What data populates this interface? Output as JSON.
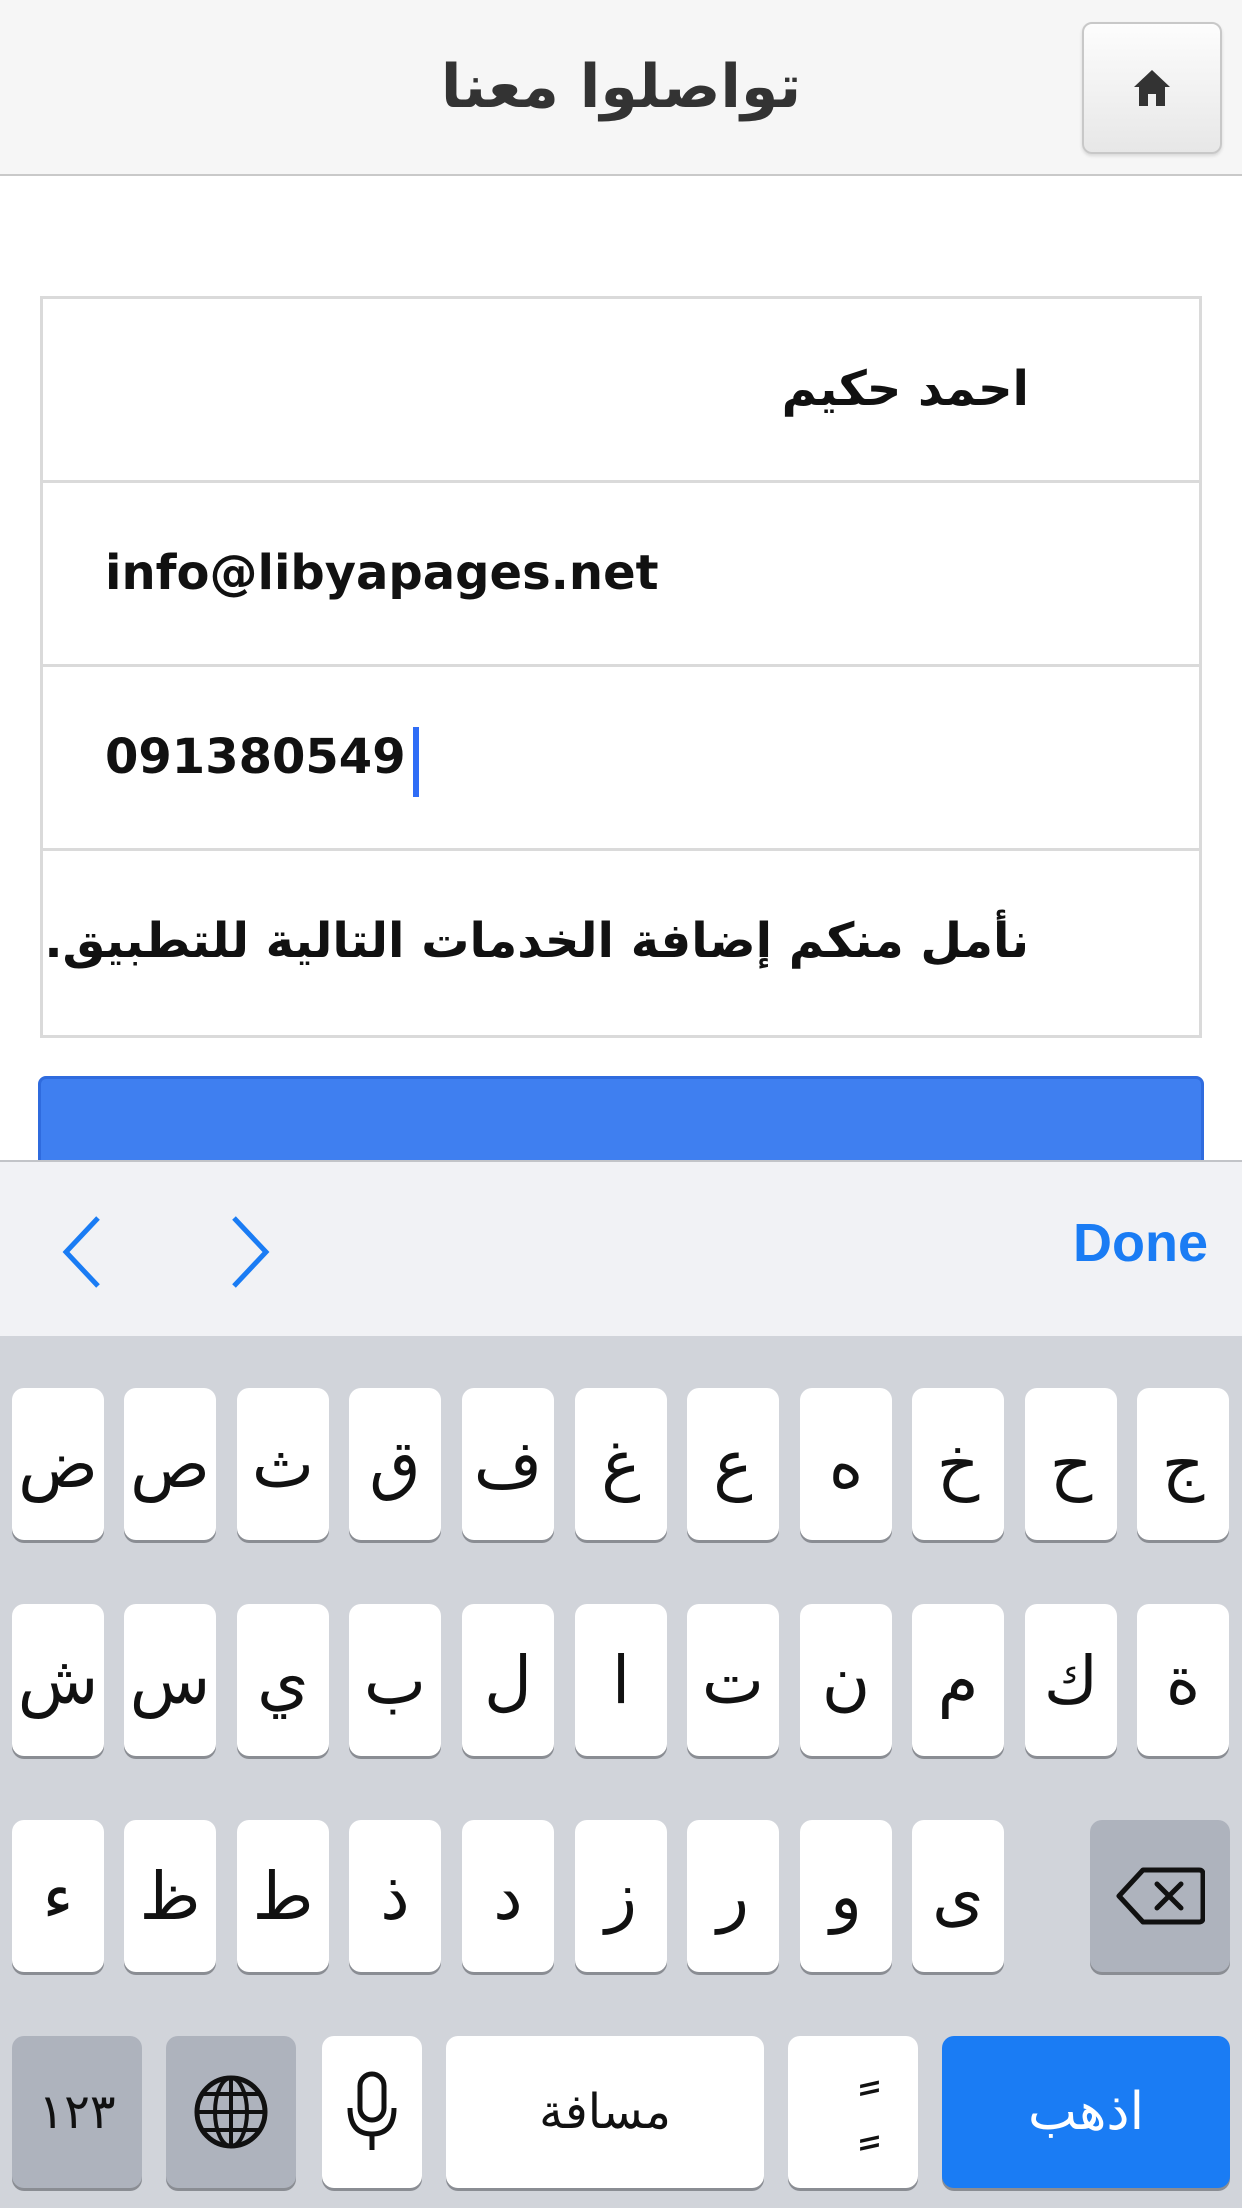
{
  "header": {
    "title": "تواصلوا معنا",
    "home_icon": "home-icon"
  },
  "form": {
    "name_value": "احمد حكيم",
    "email_value": "info@libyapages.net",
    "phone_value": "091380549",
    "message_value": "نأمل منكم إضافة الخدمات التالية للتطبيق."
  },
  "accessory": {
    "done_label": "Done",
    "prev_icon": "chevron-left-icon",
    "next_icon": "chevron-right-icon"
  },
  "keyboard": {
    "row1": [
      "ض",
      "ص",
      "ث",
      "ق",
      "ف",
      "غ",
      "ع",
      "ه",
      "خ",
      "ح",
      "ج"
    ],
    "row2": [
      "ش",
      "س",
      "ي",
      "ب",
      "ل",
      "ا",
      "ت",
      "ن",
      "م",
      "ك",
      "ة"
    ],
    "row3": [
      "ء",
      "ظ",
      "ط",
      "ذ",
      "د",
      "ز",
      "ر",
      "و",
      "ى"
    ],
    "numbers_label": "١٢٣",
    "space_label": "مسافة",
    "diacritic_label": "ًٍ",
    "go_label": "اذهب"
  },
  "colors": {
    "accent": "#1a7cf4",
    "send_button": "#3f7ff0",
    "keyboard_bg": "#d1d4da"
  }
}
